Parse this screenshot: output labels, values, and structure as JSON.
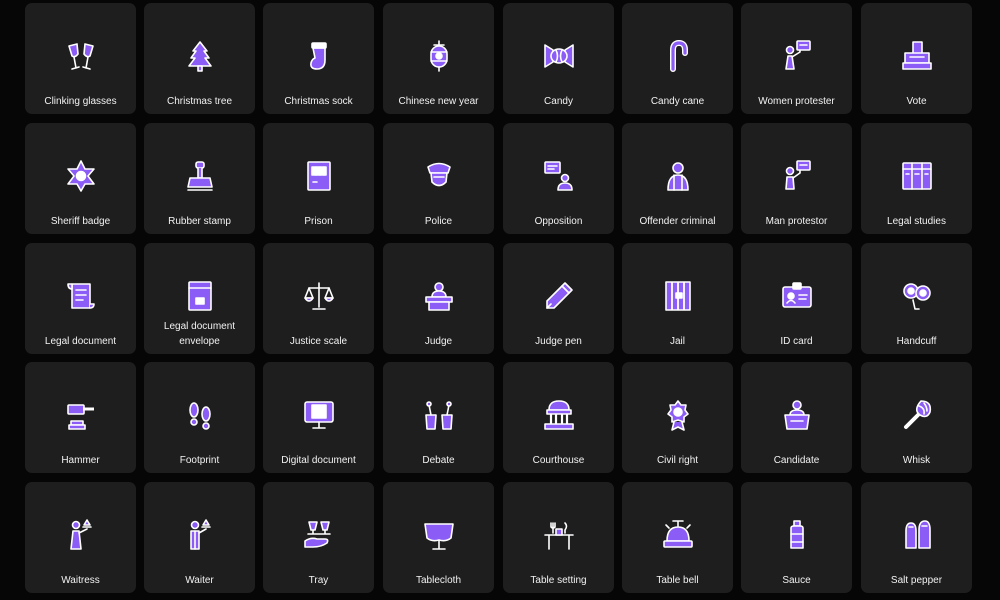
{
  "theme": {
    "background": "#060606",
    "tile": "#1e1e1e",
    "accent": "#8b5cf6",
    "stroke": "#ffffff",
    "text": "#f2f2f2"
  },
  "rows": [
    [
      {
        "label": "Clinking glasses",
        "icon": "clinking-glasses-icon"
      },
      {
        "label": "Christmas tree",
        "icon": "christmas-tree-icon"
      },
      {
        "label": "Christmas sock",
        "icon": "christmas-sock-icon"
      },
      {
        "label": "Chinese new year",
        "icon": "chinese-lantern-icon"
      },
      {
        "label": "Candy",
        "icon": "candy-icon"
      },
      {
        "label": "Candy cane",
        "icon": "candy-cane-icon"
      },
      {
        "label": "Women protester",
        "icon": "women-protester-icon"
      },
      {
        "label": "Vote",
        "icon": "vote-icon"
      }
    ],
    [
      {
        "label": "Sheriff badge",
        "icon": "sheriff-badge-icon"
      },
      {
        "label": "Rubber stamp",
        "icon": "rubber-stamp-icon"
      },
      {
        "label": "Prison",
        "icon": "prison-icon"
      },
      {
        "label": "Police",
        "icon": "police-icon"
      },
      {
        "label": "Opposition",
        "icon": "opposition-icon"
      },
      {
        "label": "Offender criminal",
        "icon": "offender-criminal-icon"
      },
      {
        "label": "Man protestor",
        "icon": "man-protestor-icon"
      },
      {
        "label": "Legal studies",
        "icon": "legal-studies-icon"
      }
    ],
    [
      {
        "label": "Legal document",
        "icon": "legal-document-icon"
      },
      {
        "label": "Legal document envelope",
        "icon": "legal-document-envelope-icon"
      },
      {
        "label": "Justice scale",
        "icon": "justice-scale-icon"
      },
      {
        "label": "Judge",
        "icon": "judge-icon"
      },
      {
        "label": "Judge pen",
        "icon": "judge-pen-icon"
      },
      {
        "label": "Jail",
        "icon": "jail-icon"
      },
      {
        "label": "ID card",
        "icon": "id-card-icon"
      },
      {
        "label": "Handcuff",
        "icon": "handcuff-icon"
      }
    ],
    [
      {
        "label": "Hammer",
        "icon": "hammer-icon"
      },
      {
        "label": "Footprint",
        "icon": "footprint-icon"
      },
      {
        "label": "Digital document",
        "icon": "digital-document-icon"
      },
      {
        "label": "Debate",
        "icon": "debate-icon"
      },
      {
        "label": "Courthouse",
        "icon": "courthouse-icon"
      },
      {
        "label": "Civil right",
        "icon": "civil-right-icon"
      },
      {
        "label": "Candidate",
        "icon": "candidate-icon"
      },
      {
        "label": "Whisk",
        "icon": "whisk-icon"
      }
    ],
    [
      {
        "label": "Waitress",
        "icon": "waitress-icon"
      },
      {
        "label": "Waiter",
        "icon": "waiter-icon"
      },
      {
        "label": "Tray",
        "icon": "tray-icon"
      },
      {
        "label": "Tablecloth",
        "icon": "tablecloth-icon"
      },
      {
        "label": "Table setting",
        "icon": "table-setting-icon"
      },
      {
        "label": "Table bell",
        "icon": "table-bell-icon"
      },
      {
        "label": "Sauce",
        "icon": "sauce-icon"
      },
      {
        "label": "Salt pepper",
        "icon": "salt-pepper-icon"
      }
    ]
  ]
}
